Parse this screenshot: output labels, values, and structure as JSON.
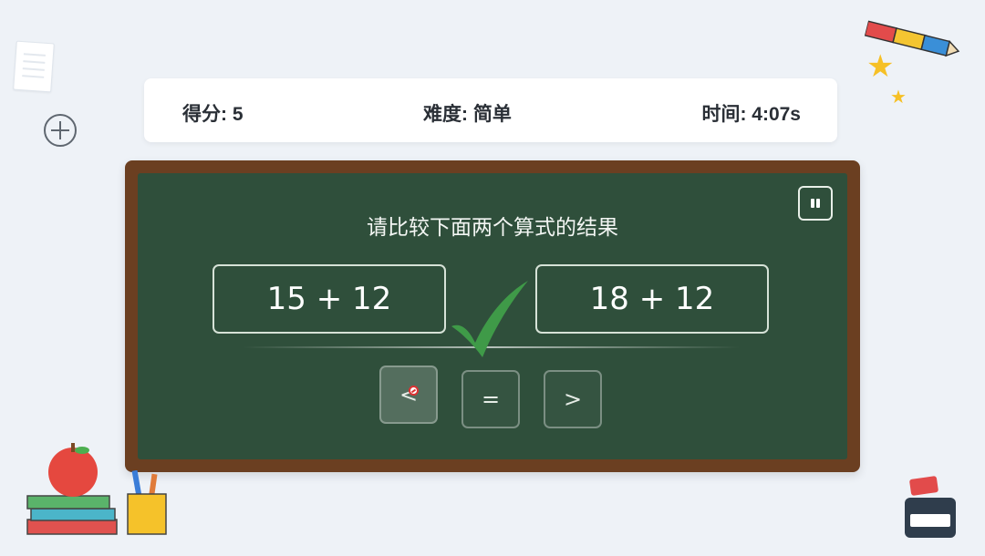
{
  "header": {
    "score_label": "得分: 5",
    "difficulty_label": "难度: 简单",
    "time_label": "时间: 4:07s"
  },
  "question": {
    "prompt": "请比较下面两个算式的结果",
    "left_expression": "15 + 12",
    "right_expression": "18 + 12"
  },
  "answer_buttons": {
    "less": "<",
    "equal": "=",
    "greater": ">"
  },
  "feedback": {
    "icon": "check-mark-icon",
    "color": "#3f9a48"
  },
  "colors": {
    "board": "#2f4f3b",
    "frame": "#6b3f21",
    "background": "#eef2f7"
  }
}
